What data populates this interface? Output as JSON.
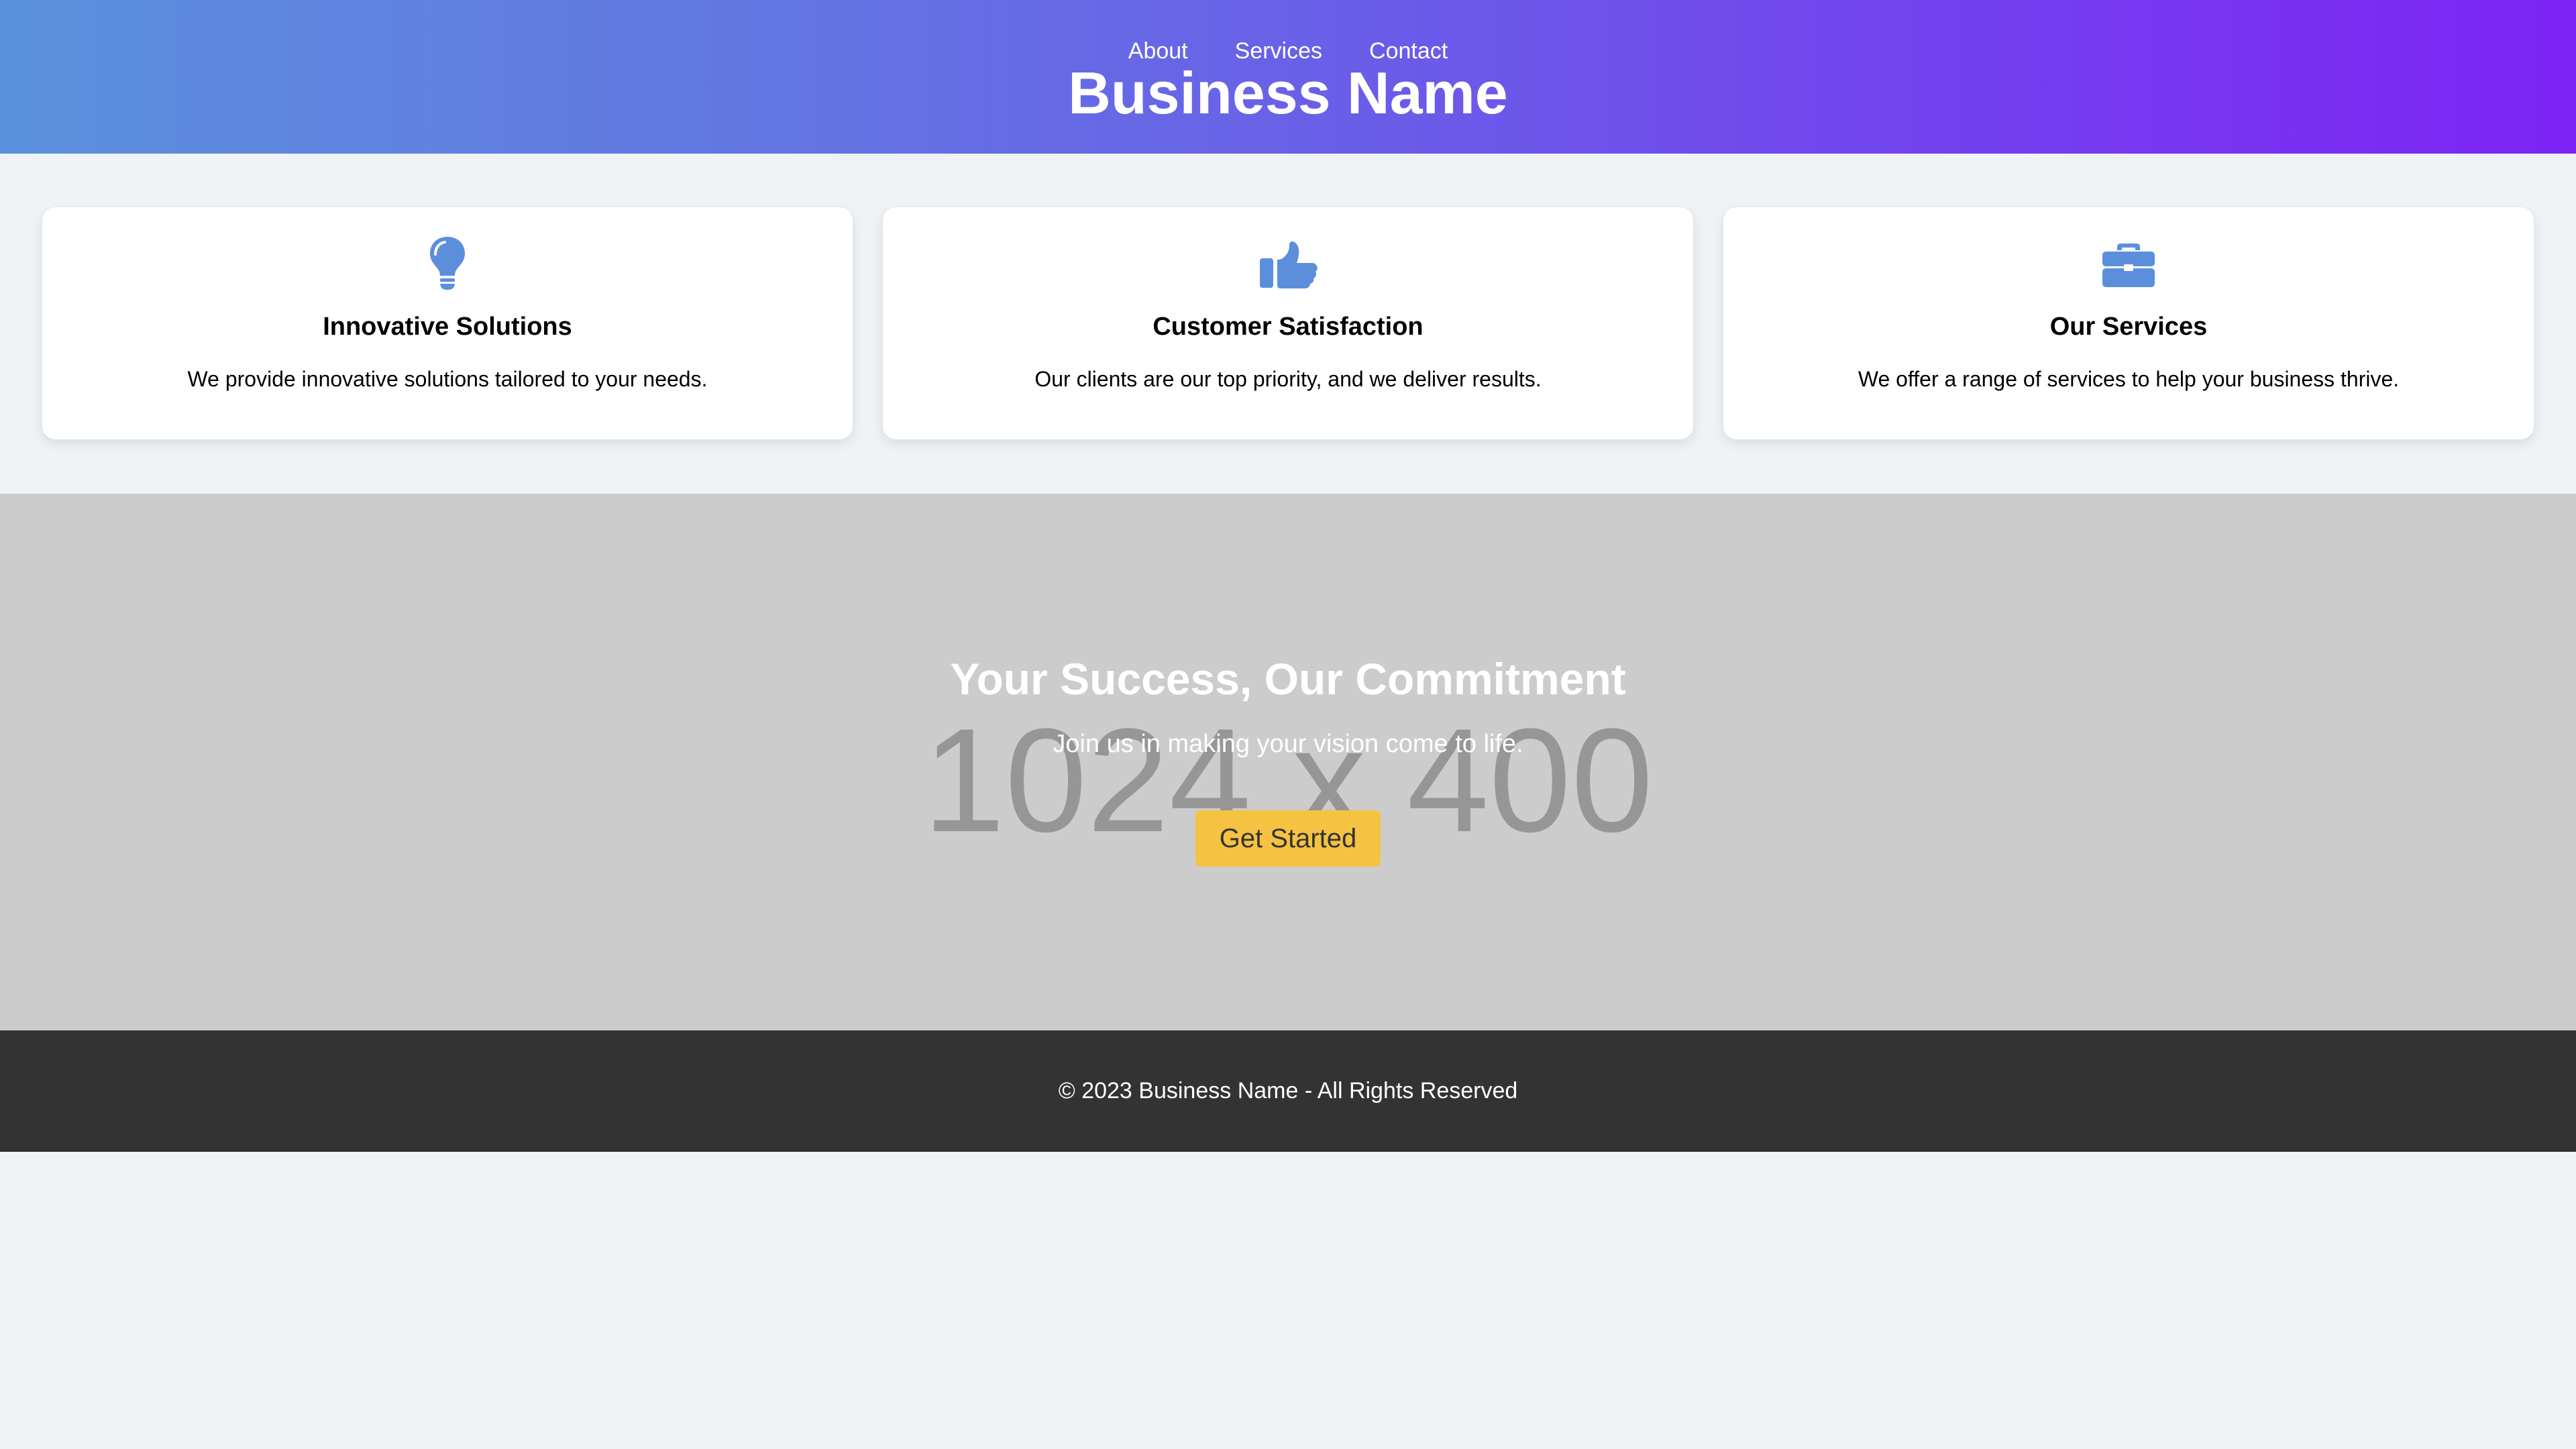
{
  "header": {
    "nav": [
      {
        "label": "About"
      },
      {
        "label": "Services"
      },
      {
        "label": "Contact"
      }
    ],
    "title": "Business Name",
    "gradient_start": "#5b91dc",
    "gradient_end": "#7d23f5"
  },
  "features": [
    {
      "icon": "lightbulb-icon",
      "title": "Innovative Solutions",
      "text": "We provide innovative solutions tailored to your needs."
    },
    {
      "icon": "thumbs-up-icon",
      "title": "Customer Satisfaction",
      "text": "Our clients are our top priority, and we deliver results."
    },
    {
      "icon": "briefcase-icon",
      "title": "Our Services",
      "text": "We offer a range of services to help your business thrive."
    }
  ],
  "hero": {
    "placeholder_text": "1024 x 400",
    "title": "Your Success, Our Commitment",
    "subtitle": "Join us in making your vision come to life.",
    "button_label": "Get Started",
    "button_color": "#f5c242"
  },
  "footer": {
    "text": "© 2023 Business Name - All Rights Reserved"
  },
  "colors": {
    "accent_icon": "#5b8fdb",
    "page_background": "#eff3f6",
    "footer_background": "#333333"
  }
}
